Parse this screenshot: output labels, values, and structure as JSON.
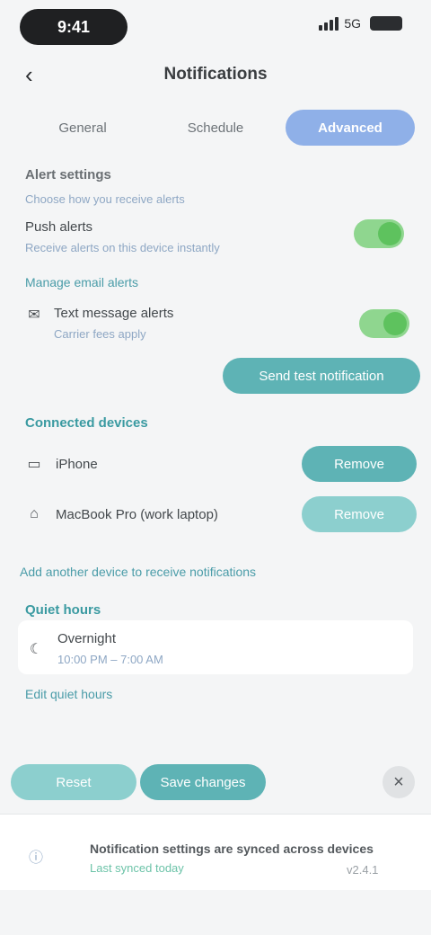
{
  "status": {
    "time": "9:41",
    "network": "5G"
  },
  "header": {
    "back_icon": "back-arrow-icon",
    "title": "Notifications"
  },
  "tabs": [
    {
      "label": "General"
    },
    {
      "label": "Schedule"
    },
    {
      "label": "Advanced"
    }
  ],
  "alerts": {
    "title": "Alert settings",
    "description": "Choose how you receive alerts",
    "push": {
      "label": "Push alerts",
      "sub": "Receive alerts on this device instantly",
      "enabled": true
    },
    "email_link": "Manage email alerts",
    "sms": {
      "label": "Text message alerts",
      "sub": "Carrier fees apply",
      "enabled": true
    },
    "test_button": "Send test notification"
  },
  "devices": {
    "title": "Connected devices",
    "items": [
      {
        "icon": "phone-icon",
        "label": "iPhone",
        "action": "Remove"
      },
      {
        "icon": "laptop-icon",
        "label": "MacBook Pro (work laptop)",
        "action": "Remove"
      }
    ],
    "add_link": "Add another device to receive notifications"
  },
  "quiet": {
    "title": "Quiet hours",
    "icon": "moon-icon",
    "label": "Overnight",
    "time": "10:00 PM – 7:00 AM",
    "edit_link": "Edit quiet hours"
  },
  "footer": {
    "primary": "Save changes",
    "secondary": "Reset",
    "close_icon": "close-icon"
  },
  "bottom": {
    "icon": "info-icon",
    "message": "Notification settings are synced across devices",
    "sub": "Last synced today",
    "meta": "v2.4.1"
  }
}
